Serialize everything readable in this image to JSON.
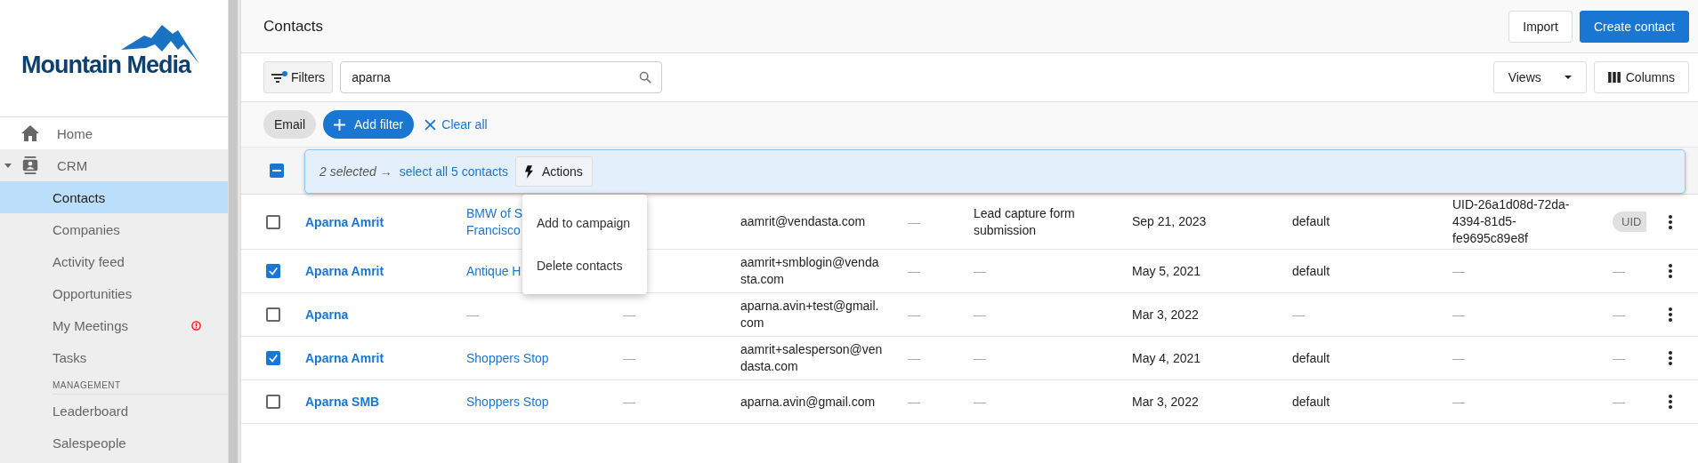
{
  "sidebar": {
    "logo": "Mountain Media",
    "items": [
      {
        "label": "Home",
        "kind": "link",
        "selected": false
      },
      {
        "label": "CRM",
        "kind": "group",
        "selected": false,
        "expanded": true,
        "children": [
          {
            "label": "Contacts",
            "selected": true,
            "alert": false
          },
          {
            "label": "Companies",
            "selected": false,
            "alert": false
          },
          {
            "label": "Activity feed",
            "selected": false,
            "alert": false
          },
          {
            "label": "Opportunities",
            "selected": false,
            "alert": false
          },
          {
            "label": "My Meetings",
            "selected": false,
            "alert": true
          },
          {
            "label": "Tasks",
            "selected": false,
            "alert": false
          }
        ]
      }
    ],
    "section": {
      "title": "MANAGEMENT",
      "items": [
        "Leaderboard",
        "Salespeople"
      ]
    }
  },
  "header": {
    "title": "Contacts",
    "buttons": [
      {
        "label": "Import",
        "kind": "secondary"
      },
      {
        "label": "Create contact",
        "kind": "primary"
      }
    ]
  },
  "toolbar": {
    "filters": "Filters",
    "filters_active": true,
    "search": {
      "value": "aparna"
    },
    "views": "Views",
    "columns": "Columns"
  },
  "filter_chips": {
    "chips": [
      "Email"
    ],
    "add": "Add filter",
    "clear": "Clear all"
  },
  "bulk_bar": {
    "select_all_partial": true,
    "count": "2 selected →",
    "select_all": "select all 5 contacts",
    "actions": "Actions",
    "menu": [
      "Add to campaign",
      "Delete contacts"
    ]
  },
  "table": {
    "rows": [
      {
        "selected": false,
        "name": "Aparna Amrit",
        "company": "BMW of S\nFrancisco",
        "email": "aamrit@vendasta.com",
        "column_5": "—",
        "source": "Lead capture form submission",
        "date": "Sep 21, 2023",
        "group": "default",
        "uid": "UID-26a1d08d-72da-4394-81d5-fe9695c89e8f",
        "column_10": {
          "kind": "chip",
          "text": "UID"
        }
      },
      {
        "selected": true,
        "name": "Aparna Amrit",
        "company": "Antique H",
        "email": "aamrit+smblogin@vendasta.com",
        "column_5": "—",
        "source": "—",
        "date": "May 5, 2021",
        "group": "default",
        "uid": "—",
        "column_10": {
          "kind": "text",
          "text": "—"
        }
      },
      {
        "selected": false,
        "name": "Aparna",
        "company": "—",
        "column_3": "—",
        "email": "aparna.avin+test@gmail.com",
        "column_5": "—",
        "source": "—",
        "date": "Mar 3, 2022",
        "group": "—",
        "uid": "—",
        "column_10": {
          "kind": "text",
          "text": "—"
        }
      },
      {
        "selected": true,
        "name": "Aparna Amrit",
        "company": "Shoppers Stop",
        "column_3": "—",
        "email": "aamrit+salesperson@vendasta.com",
        "column_5": "—",
        "source": "—",
        "date": "May 4, 2021",
        "group": "default",
        "uid": "—",
        "column_10": {
          "kind": "text",
          "text": "—"
        }
      },
      {
        "selected": false,
        "name": "Aparna SMB",
        "company": "Shoppers Stop",
        "column_3": "—",
        "email": "aparna.avin@gmail.com",
        "column_5": "—",
        "source": "—",
        "date": "Mar 3, 2022",
        "group": "default",
        "uid": "—",
        "column_10": {
          "kind": "text",
          "text": "—"
        }
      }
    ]
  }
}
